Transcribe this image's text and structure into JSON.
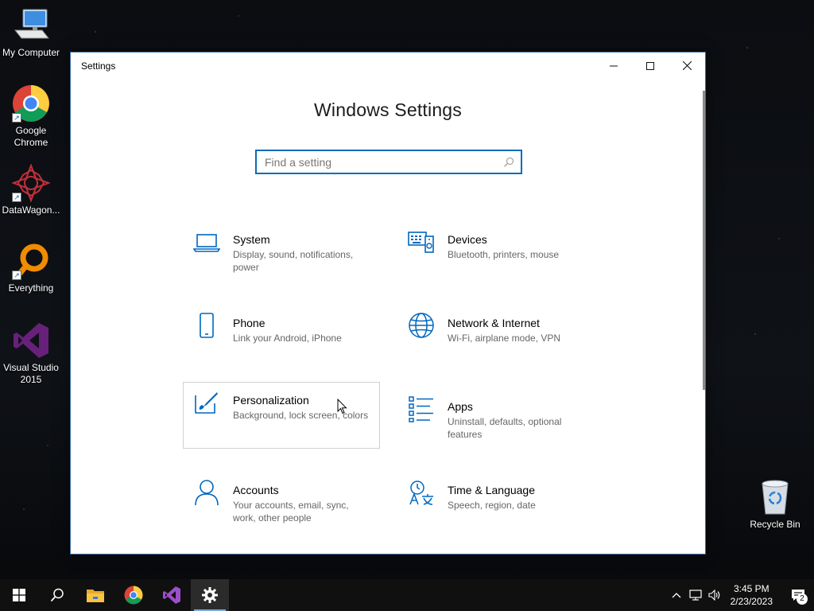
{
  "desktop": {
    "icons": [
      {
        "label": "My Computer",
        "icon": "computer-icon"
      },
      {
        "label": "Google Chrome",
        "icon": "chrome-icon"
      },
      {
        "label": "DataWagon...",
        "icon": "datawagon-icon"
      },
      {
        "label": "Everything",
        "icon": "everything-icon"
      },
      {
        "label": "Visual Studio 2015",
        "icon": "visual-studio-icon"
      }
    ],
    "recycle_bin": {
      "label": "Recycle Bin",
      "icon": "recycle-bin-icon"
    }
  },
  "window": {
    "title": "Settings",
    "controls": {
      "minimize": "minimize-icon",
      "maximize": "maximize-icon",
      "close": "close-icon"
    },
    "heading": "Windows Settings",
    "search": {
      "placeholder": "Find a setting",
      "value": "",
      "icon": "search-icon"
    },
    "accent_color": "#0067c0",
    "categories": [
      {
        "name": "System",
        "desc": "Display, sound, notifications, power",
        "icon": "laptop-icon"
      },
      {
        "name": "Devices",
        "desc": "Bluetooth, printers, mouse",
        "icon": "keyboard-speaker-icon"
      },
      {
        "name": "Phone",
        "desc": "Link your Android, iPhone",
        "icon": "phone-icon"
      },
      {
        "name": "Network & Internet",
        "desc": "Wi-Fi, airplane mode, VPN",
        "icon": "globe-icon"
      },
      {
        "name": "Personalization",
        "desc": "Background, lock screen, colors",
        "icon": "paint-brush-icon"
      },
      {
        "name": "Apps",
        "desc": "Uninstall, defaults, optional features",
        "icon": "apps-list-icon"
      },
      {
        "name": "Accounts",
        "desc": "Your accounts, email, sync, work, other people",
        "icon": "person-icon"
      },
      {
        "name": "Time & Language",
        "desc": "Speech, region, date",
        "icon": "time-language-icon"
      }
    ]
  },
  "taskbar": {
    "apps": [
      "windows-start-icon",
      "search-icon",
      "file-explorer-icon",
      "chrome-icon",
      "visual-studio-icon",
      "settings-gear-icon"
    ],
    "tray_icons": [
      "chevron-up-icon",
      "network-icon",
      "volume-icon"
    ],
    "time": "3:45 PM",
    "date": "2/23/2023",
    "notification_count": "2"
  }
}
